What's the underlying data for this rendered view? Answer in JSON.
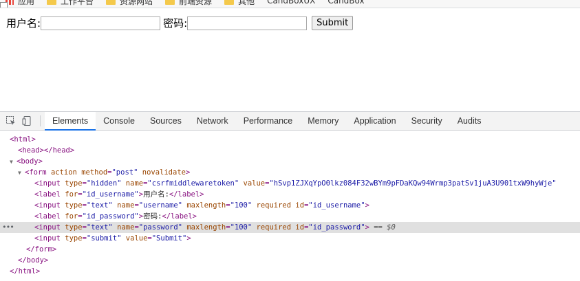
{
  "bookmarks": [
    {
      "icon": "apps-icon",
      "label": "应用"
    },
    {
      "icon": "folder-icon",
      "label": "工作平台"
    },
    {
      "icon": "folder-icon",
      "label": "资源网站"
    },
    {
      "icon": "folder-icon",
      "label": "前端资源"
    },
    {
      "icon": "folder-icon",
      "label": "其他"
    },
    {
      "icon": "page-icon",
      "label": "CandBoxUX"
    },
    {
      "icon": "page-icon",
      "label": "CandBox"
    }
  ],
  "form": {
    "username_label": "用户名:",
    "username_value": "",
    "password_label": "密码:",
    "password_value": "",
    "submit_label": "Submit"
  },
  "devtools": {
    "tabs": [
      "Elements",
      "Console",
      "Sources",
      "Network",
      "Performance",
      "Memory",
      "Application",
      "Security",
      "Audits"
    ],
    "active_tab": "Elements",
    "dom": {
      "html_open": "<html>",
      "head": "<head></head>",
      "body_open": "<body>",
      "form_tag": "form",
      "form_attr1": "action",
      "form_attr2": "method",
      "form_attr2_val": "\"post\"",
      "form_attr3": "novalidate",
      "hidden_name_val": "\"csrfmiddlewaretoken\"",
      "hidden_value_val": "\"hSvp1ZJXqYpO0lkz084F32wBYm9pFDaKQw94Wrmp3patSv1juA3U901txW9hyWje\"",
      "label1_for": "\"id_username\"",
      "label1_text": "用户名:",
      "username_input_name": "\"username\"",
      "username_maxlength": "\"100\"",
      "username_id": "\"id_username\"",
      "label2_for": "\"id_password\"",
      "label2_text": "密码:",
      "password_input_name": "\"password\"",
      "password_maxlength": "\"100\"",
      "password_id": "\"id_password\"",
      "selected_marker": "== $0",
      "submit_value": "\"Submit\"",
      "form_close": "</form>",
      "body_close": "</body>",
      "html_close": "</html>"
    }
  }
}
